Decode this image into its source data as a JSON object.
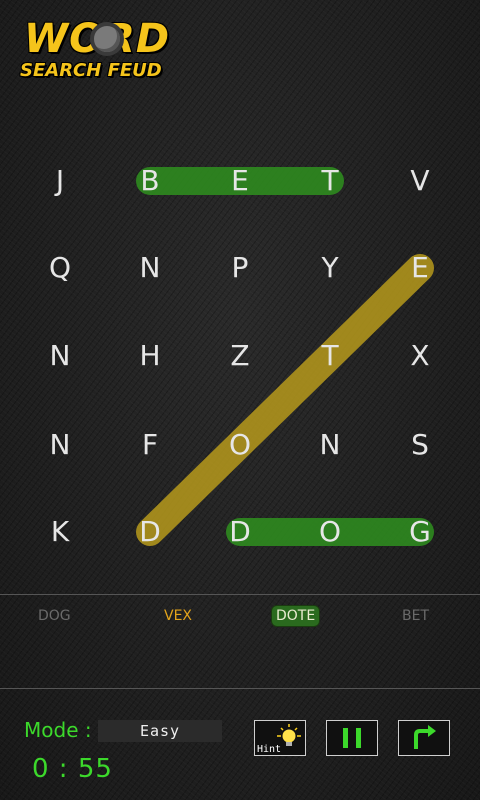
{
  "logo": {
    "title": "WORD",
    "subtitle": "SEARCH FEUD"
  },
  "grid": {
    "rows": [
      [
        "J",
        "B",
        "E",
        "T",
        "V"
      ],
      [
        "Q",
        "N",
        "P",
        "Y",
        "E"
      ],
      [
        "N",
        "H",
        "Z",
        "T",
        "X"
      ],
      [
        "N",
        "F",
        "O",
        "N",
        "S"
      ],
      [
        "K",
        "D",
        "D",
        "O",
        "G"
      ]
    ],
    "highlights": [
      {
        "word": "BET",
        "from": [
          0,
          1
        ],
        "to": [
          0,
          3
        ],
        "color": "#2e8a1f"
      },
      {
        "word": "DOG",
        "from": [
          4,
          2
        ],
        "to": [
          4,
          4
        ],
        "color": "#2e8a1f"
      },
      {
        "word": "DOTE",
        "from": [
          4,
          1
        ],
        "to": [
          1,
          4
        ],
        "color": "#b79a1c"
      }
    ]
  },
  "words": [
    {
      "label": "DOG",
      "state": "found"
    },
    {
      "label": "VEX",
      "state": "pending"
    },
    {
      "label": "DOTE",
      "state": "current"
    },
    {
      "label": "BET",
      "state": "found"
    }
  ],
  "mode": {
    "label": "Mode :",
    "value": "Easy"
  },
  "timer": "0 : 55",
  "buttons": {
    "hint_label": "Hint"
  },
  "colors": {
    "accent_green": "#3cd92b",
    "found_green": "#2e8a1f",
    "hint_gold": "#b79a1c"
  }
}
